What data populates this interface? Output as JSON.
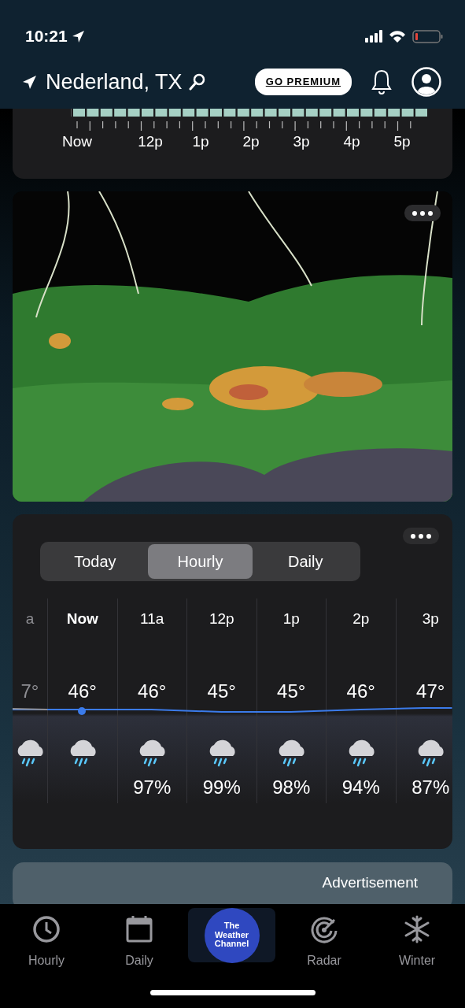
{
  "status_bar": {
    "time": "10:21"
  },
  "header": {
    "location": "Nederland, TX",
    "premium_button": "GO PREMIUM"
  },
  "precip_timeline": {
    "labels": [
      "Now",
      "12p",
      "1p",
      "2p",
      "3p",
      "4p",
      "5p"
    ]
  },
  "forecast": {
    "tabs": [
      {
        "label": "Today",
        "selected": false
      },
      {
        "label": "Hourly",
        "selected": true
      },
      {
        "label": "Daily",
        "selected": false
      }
    ],
    "hours": [
      {
        "time": "a",
        "temp": "7°",
        "past": true,
        "current": false
      },
      {
        "time": "Now",
        "temp": "46°",
        "past": false,
        "current": true
      },
      {
        "time": "11a",
        "temp": "46°",
        "precip": "97%",
        "past": false,
        "current": false
      },
      {
        "time": "12p",
        "temp": "45°",
        "precip": "99%",
        "past": false,
        "current": false
      },
      {
        "time": "1p",
        "temp": "45°",
        "precip": "98%",
        "past": false,
        "current": false
      },
      {
        "time": "2p",
        "temp": "46°",
        "precip": "94%",
        "past": false,
        "current": false
      },
      {
        "time": "3p",
        "temp": "47°",
        "precip": "87%",
        "past": false,
        "current": false
      }
    ]
  },
  "advertisement": {
    "label": "Advertisement"
  },
  "tab_bar": {
    "items": [
      {
        "kind": "clock",
        "label": "Hourly"
      },
      {
        "kind": "calendar",
        "label": "Daily"
      },
      {
        "kind": "logo",
        "lines": [
          "The",
          "Weather",
          "Channel"
        ]
      },
      {
        "kind": "radar",
        "label": "Radar"
      },
      {
        "kind": "snowflake",
        "label": "Winter"
      }
    ]
  }
}
